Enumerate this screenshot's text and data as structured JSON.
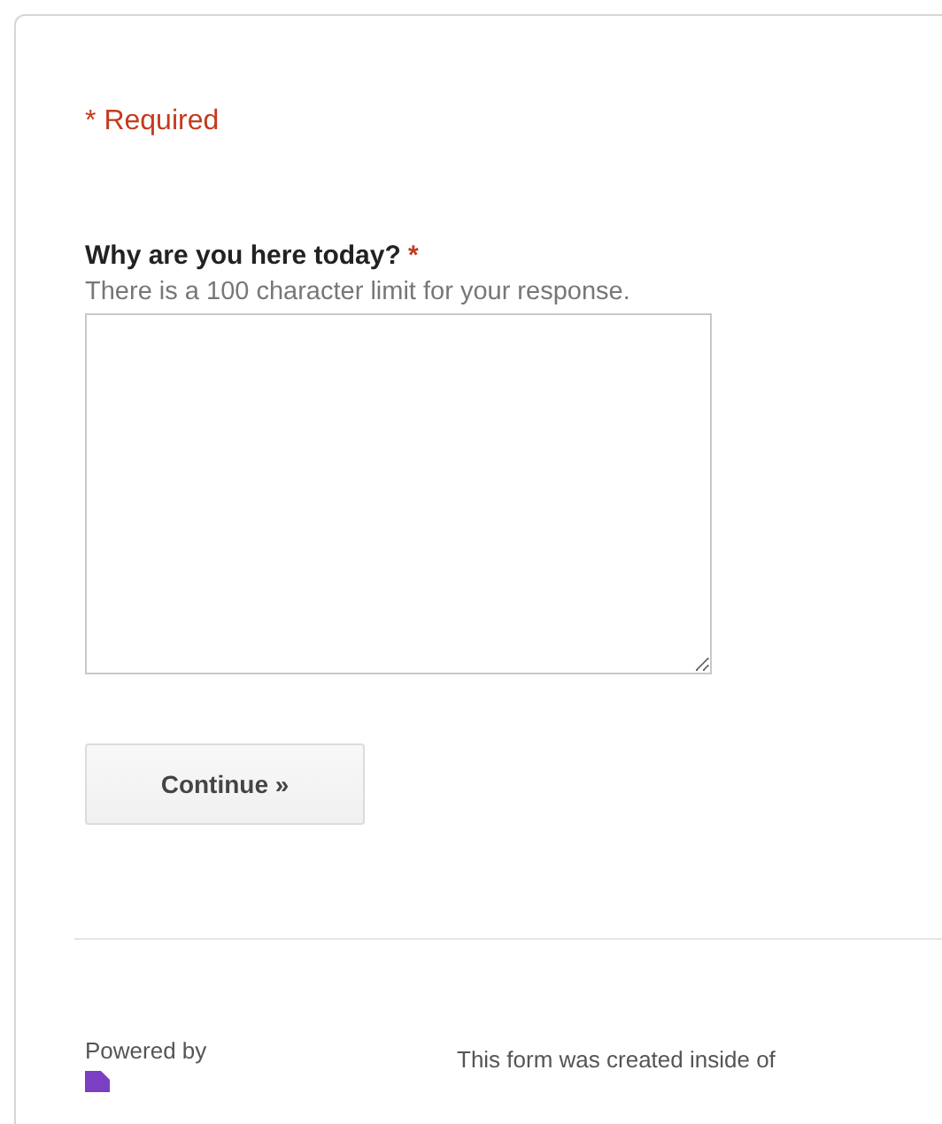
{
  "required_note": {
    "mark": "*",
    "label": "Required"
  },
  "question": {
    "title": "Why are you here today?",
    "required_mark": "*",
    "help": "There is a 100 character limit for your response."
  },
  "continue_button": "Continue »",
  "footer": {
    "powered_by": "Powered by",
    "note": "This form was created inside of"
  }
}
